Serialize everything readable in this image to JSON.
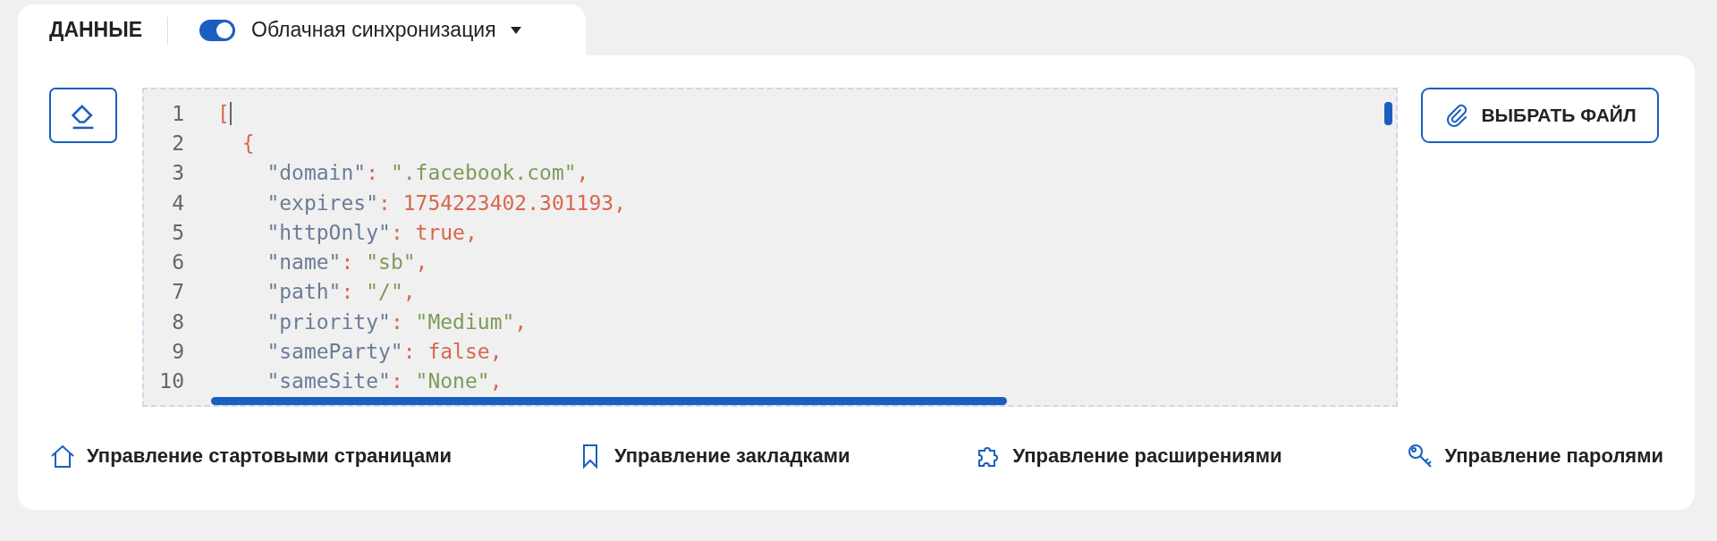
{
  "tab": {
    "label": "ДАННЫЕ",
    "sync_toggle": {
      "on": true,
      "label": "Облачная синхронизация"
    }
  },
  "editor": {
    "lines": [
      {
        "number": "1",
        "tokens": [
          {
            "text": "[",
            "kind": "bracket"
          }
        ],
        "cursor": true
      },
      {
        "number": "2",
        "tokens": [
          {
            "text": "  {",
            "kind": "bracket"
          }
        ],
        "cursor": false
      },
      {
        "number": "3",
        "tokens": [
          {
            "text": "    \"domain\"",
            "kind": "key"
          },
          {
            "text": ": ",
            "kind": "punct"
          },
          {
            "text": "\".facebook.com\"",
            "kind": "string"
          },
          {
            "text": ",",
            "kind": "punct"
          }
        ],
        "cursor": false
      },
      {
        "number": "4",
        "tokens": [
          {
            "text": "    \"expires\"",
            "kind": "key"
          },
          {
            "text": ": ",
            "kind": "punct"
          },
          {
            "text": "1754223402.301193",
            "kind": "number"
          },
          {
            "text": ",",
            "kind": "punct"
          }
        ],
        "cursor": false
      },
      {
        "number": "5",
        "tokens": [
          {
            "text": "    \"httpOnly\"",
            "kind": "key"
          },
          {
            "text": ": ",
            "kind": "punct"
          },
          {
            "text": "true",
            "kind": "number"
          },
          {
            "text": ",",
            "kind": "punct"
          }
        ],
        "cursor": false
      },
      {
        "number": "6",
        "tokens": [
          {
            "text": "    \"name\"",
            "kind": "key"
          },
          {
            "text": ": ",
            "kind": "punct"
          },
          {
            "text": "\"sb\"",
            "kind": "string"
          },
          {
            "text": ",",
            "kind": "punct"
          }
        ],
        "cursor": false
      },
      {
        "number": "7",
        "tokens": [
          {
            "text": "    \"path\"",
            "kind": "key"
          },
          {
            "text": ": ",
            "kind": "punct"
          },
          {
            "text": "\"/\"",
            "kind": "string"
          },
          {
            "text": ",",
            "kind": "punct"
          }
        ],
        "cursor": false
      },
      {
        "number": "8",
        "tokens": [
          {
            "text": "    \"priority\"",
            "kind": "key"
          },
          {
            "text": ": ",
            "kind": "punct"
          },
          {
            "text": "\"Medium\"",
            "kind": "string"
          },
          {
            "text": ",",
            "kind": "punct"
          }
        ],
        "cursor": false
      },
      {
        "number": "9",
        "tokens": [
          {
            "text": "    \"sameParty\"",
            "kind": "key"
          },
          {
            "text": ": ",
            "kind": "punct"
          },
          {
            "text": "false",
            "kind": "number"
          },
          {
            "text": ",",
            "kind": "punct"
          }
        ],
        "cursor": false
      },
      {
        "number": "10",
        "tokens": [
          {
            "text": "    \"sameSite\"",
            "kind": "key"
          },
          {
            "text": ": ",
            "kind": "punct"
          },
          {
            "text": "\"None\"",
            "kind": "string"
          },
          {
            "text": ",",
            "kind": "punct"
          }
        ],
        "cursor": false
      }
    ]
  },
  "choose_file_button": {
    "label": "ВЫБРАТЬ ФАЙЛ"
  },
  "links": [
    {
      "kind": "home",
      "label": "Управление стартовыми страницами"
    },
    {
      "kind": "bookmark",
      "label": "Управление закладками"
    },
    {
      "kind": "puzzle",
      "label": "Управление расширениями"
    },
    {
      "kind": "key",
      "label": "Управление паролями"
    }
  ]
}
